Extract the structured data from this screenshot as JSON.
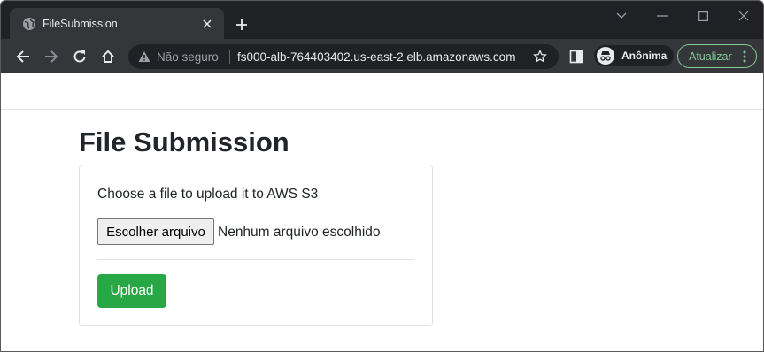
{
  "browser": {
    "tab": {
      "title": "FileSubmission",
      "favicon_icon": "globe-icon"
    },
    "omnibox": {
      "security_label": "Não seguro",
      "url": "fs000-alb-764403402.us-east-2.elb.amazonaws.com"
    },
    "profile": {
      "label": "Anônima",
      "icon": "incognito-icon"
    },
    "update_button": {
      "label": "Atualizar",
      "color": "#81c995"
    },
    "colors": {
      "tabstrip": "#202124",
      "toolbar": "#35363a"
    }
  },
  "page": {
    "title": "File Submission",
    "card": {
      "instructions": "Choose a file to upload it to AWS S3",
      "file_input": {
        "button_label": "Escolher arquivo",
        "status": "Nenhum arquivo escolhido"
      },
      "upload_button": {
        "label": "Upload",
        "color": "#28a745"
      }
    }
  }
}
